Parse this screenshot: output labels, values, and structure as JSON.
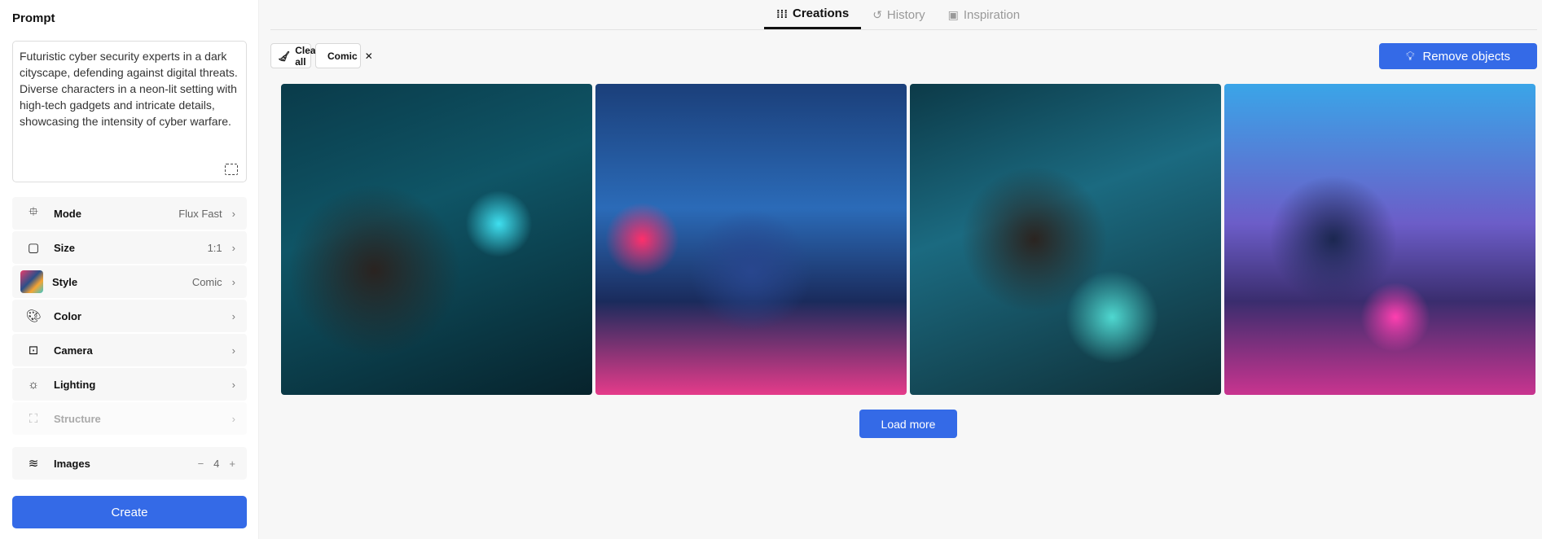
{
  "sidebar": {
    "prompt_title": "Prompt",
    "prompt_text": "Futuristic cyber security experts in a dark cityscape, defending against digital threats. Diverse characters in a neon-lit setting with high-tech gadgets and intricate details, showcasing the intensity of cyber warfare.",
    "settings": [
      {
        "label": "Mode",
        "value": "Flux Fast",
        "icon": "chip-icon"
      },
      {
        "label": "Size",
        "value": "1:1",
        "icon": "square-icon"
      },
      {
        "label": "Style",
        "value": "Comic",
        "icon": "style-thumbnail"
      },
      {
        "label": "Color",
        "value": "",
        "icon": "palette-icon"
      },
      {
        "label": "Camera",
        "value": "",
        "icon": "camera-portrait-icon"
      },
      {
        "label": "Lighting",
        "value": "",
        "icon": "sun-icon"
      },
      {
        "label": "Structure",
        "value": "",
        "icon": "structure-icon",
        "disabled": true
      }
    ],
    "images": {
      "label": "Images",
      "count": "4"
    },
    "create_label": "Create"
  },
  "tabs": [
    {
      "label": "Creations",
      "active": true
    },
    {
      "label": "History"
    },
    {
      "label": "Inspiration"
    }
  ],
  "toolbar": {
    "clear_all": "Clear all",
    "filter_chip": "Comic",
    "remove_objects": "Remove objects"
  },
  "gallery": {
    "count": 4
  },
  "load_more": "Load more",
  "colors": {
    "accent": "#346ae7"
  }
}
